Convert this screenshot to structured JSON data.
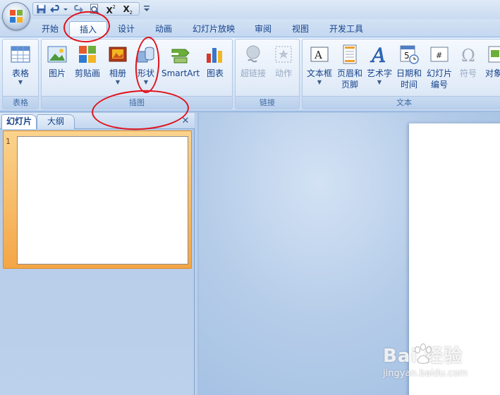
{
  "quick_access": {
    "items": [
      "save-icon",
      "undo-icon",
      "redo-icon",
      "print-preview-icon",
      "superscript-icon",
      "subscript-icon",
      "customize-icon"
    ]
  },
  "ribbon_tabs": [
    {
      "label": "开始",
      "active": false
    },
    {
      "label": "插入",
      "active": true
    },
    {
      "label": "设计",
      "active": false
    },
    {
      "label": "动画",
      "active": false
    },
    {
      "label": "幻灯片放映",
      "active": false
    },
    {
      "label": "审阅",
      "active": false
    },
    {
      "label": "视图",
      "active": false
    },
    {
      "label": "开发工具",
      "active": false
    }
  ],
  "groups": {
    "table": {
      "label": "表格",
      "buttons": [
        {
          "label": "表格",
          "icon": "table-icon",
          "dropdown": true
        }
      ]
    },
    "illustrations": {
      "label": "插图",
      "buttons": [
        {
          "label": "图片",
          "icon": "picture-icon"
        },
        {
          "label": "剪贴画",
          "icon": "clipart-icon"
        },
        {
          "label": "相册",
          "icon": "photo-album-icon",
          "dropdown": true
        },
        {
          "label": "形状",
          "icon": "shapes-icon",
          "dropdown": true
        },
        {
          "label": "SmartArt",
          "icon": "smartart-icon"
        },
        {
          "label": "图表",
          "icon": "chart-icon"
        }
      ]
    },
    "links": {
      "label": "链接",
      "buttons": [
        {
          "label": "超链接",
          "icon": "hyperlink-icon",
          "disabled": true
        },
        {
          "label": "动作",
          "icon": "action-icon",
          "disabled": true
        }
      ]
    },
    "text": {
      "label": "文本",
      "buttons": [
        {
          "label": "文本框",
          "icon": "textbox-icon",
          "dropdown": true
        },
        {
          "label": "页眉和",
          "label2": "页脚",
          "icon": "header-footer-icon"
        },
        {
          "label": "艺术字",
          "icon": "wordart-icon",
          "dropdown": true
        },
        {
          "label": "日期和",
          "label2": "时间",
          "icon": "date-time-icon"
        },
        {
          "label": "幻灯片",
          "label2": "编号",
          "icon": "slide-number-icon"
        },
        {
          "label": "符号",
          "icon": "symbol-icon"
        },
        {
          "label": "对象",
          "icon": "object-icon"
        }
      ]
    }
  },
  "pane": {
    "tabs": [
      "幻灯片",
      "大纲"
    ],
    "active_tab": "幻灯片",
    "close_glyph": "✕",
    "slides": [
      {
        "number": "1"
      }
    ]
  },
  "watermark": {
    "logo": "Bai  经验",
    "url": "jingyan.baidu.com"
  },
  "colors": {
    "accent": "#15428b",
    "annotation": "#e0121a",
    "selected_slide": "#f4a646"
  }
}
